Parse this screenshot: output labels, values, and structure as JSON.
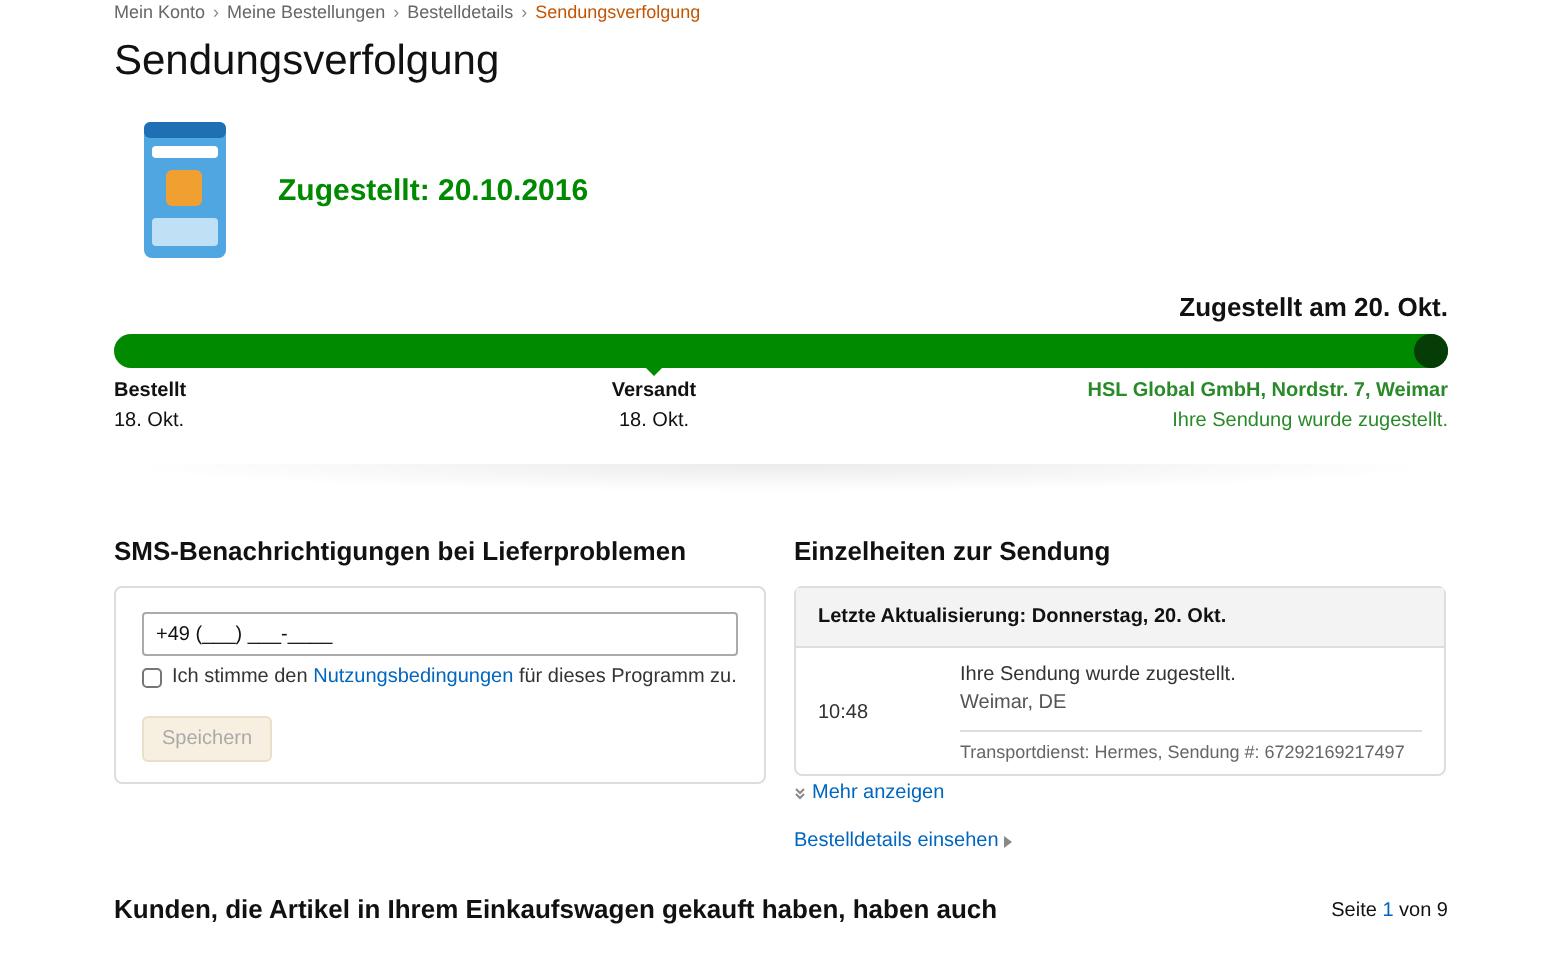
{
  "breadcrumb_separator": "›",
  "breadcrumb": [
    {
      "label": "Mein Konto",
      "selected": false
    },
    {
      "label": "Meine Bestellungen",
      "selected": false
    },
    {
      "label": "Bestelldetails",
      "selected": false
    },
    {
      "label": "Sendungsverfolgung",
      "selected": true
    }
  ],
  "title": "Sendungsverfolgung",
  "product": {
    "status": "Zugestellt: 20.10.2016"
  },
  "progress": {
    "heading": "Zugestellt am 20. Okt.",
    "level": 1,
    "steps": [
      {
        "kind": "ordered",
        "label": "Bestellt",
        "date": "18. Okt."
      },
      {
        "kind": "shipped",
        "label": "Versandt",
        "date": "18. Okt."
      }
    ],
    "destination": {
      "address": "HSL Global GmbH, Nordstr. 7, Weimar",
      "message": "Ihre Sendung wurde zugestellt."
    }
  },
  "sms": {
    "title": "SMS-Benachrichtigungen bei Lieferproblemen",
    "phone": "+49 (___) ___-____",
    "consent": {
      "checked": false,
      "before": "Ich stimme den",
      "link": "Nutzungsbedingungen",
      "after": "für dieses Programm zu."
    },
    "button": {
      "label": "Speichern",
      "disabled": true
    }
  },
  "details": {
    "title": "Einzelheiten zur Sendung",
    "update": "Letzte Aktualisierung: Donnerstag, 20. Okt.",
    "time": "10:48",
    "message": "Ihre Sendung wurde zugestellt.",
    "location": "Weimar, DE",
    "carrier": "Transportdienst: Hermes, Sendung #: 67292169217497",
    "more": "Mehr anzeigen",
    "order_link": "Bestelldetails einsehen"
  },
  "recommendations": {
    "title": "Kunden, die Artikel in Ihrem Einkaufswagen gekauft haben, haben auch",
    "pager": {
      "before": "Seite",
      "current": "1",
      "after": "von 9"
    }
  }
}
